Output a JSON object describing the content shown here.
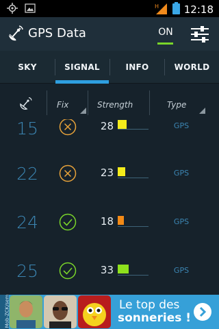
{
  "status_bar": {
    "time": "12:18",
    "left_icons": [
      "gps-icon",
      "image-icon"
    ],
    "right_icons": [
      "signal-icon",
      "battery-icon"
    ]
  },
  "action_bar": {
    "title": "GPS Data",
    "toggle_label": "ON",
    "toggle_color": "#7ad52a",
    "icons": [
      "satellite-dish-icon",
      "settings-sliders-icon"
    ]
  },
  "tabs": {
    "items": [
      {
        "label": "SKY"
      },
      {
        "label": "SIGNAL"
      },
      {
        "label": "INFO"
      },
      {
        "label": "WORLD"
      }
    ],
    "active": "SIGNAL",
    "accent": "#2e9fe0"
  },
  "table": {
    "columns": {
      "prn_icon": "satellite-icon",
      "fix": "Fix",
      "strength": "Strength",
      "type": "Type"
    },
    "rows": [
      {
        "prn": "15",
        "fix": false,
        "strength": "28",
        "strength_value": 28,
        "bar_color": "#f4ec1b",
        "type": "GPS"
      },
      {
        "prn": "22",
        "fix": false,
        "strength": "23",
        "strength_value": 23,
        "bar_color": "#f4ec1b",
        "type": "GPS"
      },
      {
        "prn": "24",
        "fix": true,
        "strength": "18",
        "strength_value": 18,
        "bar_color": "#f38a16",
        "type": "GPS"
      },
      {
        "prn": "25",
        "fix": true,
        "strength": "33",
        "strength_value": 33,
        "bar_color": "#8ee11d",
        "type": "GPS"
      }
    ],
    "colors": {
      "fix_true": "#7ad52a",
      "fix_false": "#e8a33a",
      "prn": "#3c86b3"
    }
  },
  "ad": {
    "side_text": "Mob-ZCK/sem",
    "line1": "Le top des",
    "line2": "sonneries !",
    "icons": [
      "portrait-man-icon",
      "portrait-sunglasses-icon",
      "cartoon-chick-icon",
      "chevron-right-icon"
    ],
    "color": "#36a0d8"
  }
}
